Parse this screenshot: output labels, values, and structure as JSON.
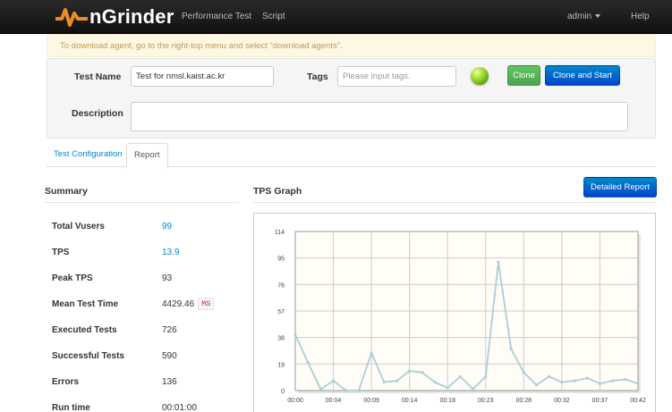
{
  "navbar": {
    "brand": "nGrinder",
    "performance_test": "Performance Test",
    "script": "Script",
    "admin": "admin",
    "help": "Help"
  },
  "alert": {
    "text": "To download agent, go to the right-top menu and select \"download agents\"."
  },
  "form": {
    "test_name_label": "Test Name",
    "test_name_value": "Test for nmsl.kaist.ac.kr",
    "tags_label": "Tags",
    "tags_placeholder": "Please input tags.",
    "description_label": "Description",
    "description_value": "",
    "clone_label": "Clone",
    "clone_and_start_label": "Clone and Start",
    "status_color": "#7ed321"
  },
  "tabs": [
    {
      "label": "Test Configuration",
      "active": false
    },
    {
      "label": "Report",
      "active": true
    }
  ],
  "summary": {
    "title": "Summary",
    "stats": [
      {
        "label": "Total Vusers",
        "value": "99",
        "link": true
      },
      {
        "label": "TPS",
        "value": "13.9",
        "link": true
      },
      {
        "label": "Peak TPS",
        "value": "93",
        "link": false
      },
      {
        "label": "Mean Test Time",
        "value": "4429.46",
        "unit": "MS",
        "link": false
      },
      {
        "label": "Executed Tests",
        "value": "726",
        "link": false
      },
      {
        "label": "Successful Tests",
        "value": "590",
        "link": false
      },
      {
        "label": "Errors",
        "value": "136",
        "link": false
      },
      {
        "label": "Run time",
        "value": "00:01:00",
        "link": false
      }
    ]
  },
  "graph": {
    "title": "TPS Graph",
    "detailed_report_label": "Detailed Report"
  },
  "chart_data": {
    "type": "line",
    "title": "",
    "xlabel": "",
    "ylabel": "",
    "ylim": [
      0,
      114
    ],
    "y_ticks": [
      0,
      19,
      38,
      57,
      76,
      95,
      114
    ],
    "x_tick_labels": [
      "00:00",
      "00:04",
      "00:09",
      "00:14",
      "00:18",
      "00:23",
      "00:28",
      "00:32",
      "00:37",
      "00:42"
    ],
    "grid": true,
    "series": [
      {
        "name": "",
        "color": "#a8cfd8",
        "x": [
          0,
          1,
          2,
          3,
          4,
          5,
          6,
          7,
          8,
          9,
          10,
          11,
          12,
          13,
          14,
          15,
          16,
          17,
          18,
          19,
          20,
          21,
          22,
          23,
          24,
          25,
          26,
          27
        ],
        "values": [
          40,
          20,
          1,
          7,
          0,
          0,
          27,
          6,
          7,
          14,
          13,
          6,
          2,
          10,
          1,
          10,
          92,
          30,
          13,
          4,
          10,
          6,
          7,
          9,
          5,
          7,
          8,
          5
        ]
      }
    ]
  }
}
